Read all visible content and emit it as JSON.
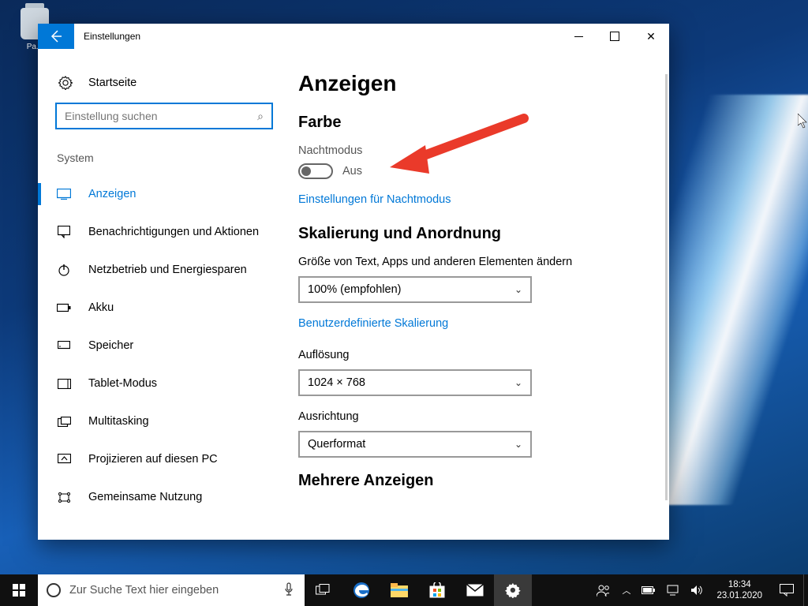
{
  "desktop": {
    "recycle_bin_label": "Pa..."
  },
  "window": {
    "title": "Einstellungen",
    "home_label": "Startseite",
    "search_placeholder": "Einstellung suchen",
    "group_label": "System",
    "nav": [
      {
        "label": "Anzeigen",
        "active": true
      },
      {
        "label": "Benachrichtigungen und Aktionen"
      },
      {
        "label": "Netzbetrieb und Energiesparen"
      },
      {
        "label": "Akku"
      },
      {
        "label": "Speicher"
      },
      {
        "label": "Tablet-Modus"
      },
      {
        "label": "Multitasking"
      },
      {
        "label": "Projizieren auf diesen PC"
      },
      {
        "label": "Gemeinsame Nutzung"
      }
    ]
  },
  "content": {
    "page_title": "Anzeigen",
    "color_heading": "Farbe",
    "night_mode_label": "Nachtmodus",
    "toggle_state": "Aus",
    "night_mode_link": "Einstellungen für Nachtmodus",
    "scaling_heading": "Skalierung und Anordnung",
    "scale_label": "Größe von Text, Apps und anderen Elementen ändern",
    "scale_value": "100% (empfohlen)",
    "custom_scaling_link": "Benutzerdefinierte Skalierung",
    "resolution_label": "Auflösung",
    "resolution_value": "1024 × 768",
    "orientation_label": "Ausrichtung",
    "orientation_value": "Querformat",
    "multi_heading": "Mehrere Anzeigen"
  },
  "taskbar": {
    "search_placeholder": "Zur Suche Text hier eingeben",
    "time": "18:34",
    "date": "23.01.2020"
  }
}
